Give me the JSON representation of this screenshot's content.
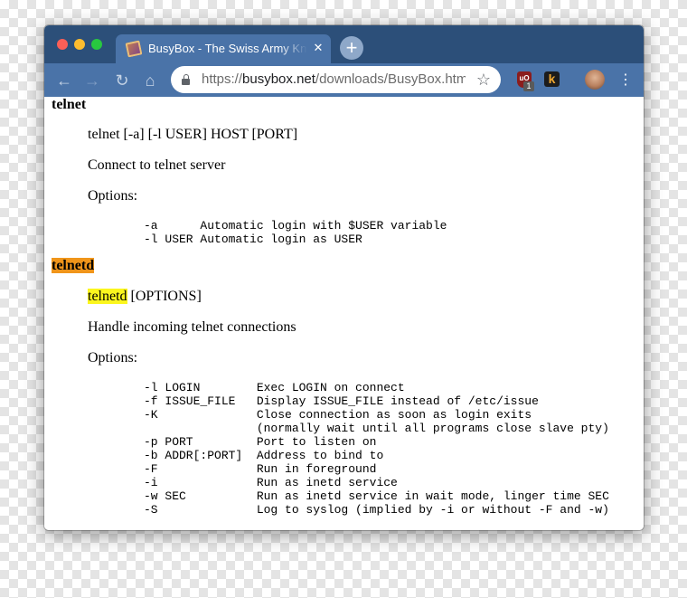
{
  "browser": {
    "tab_title": "BusyBox - The Swiss Army Knife of Embedded Linux",
    "tab_close": "✕",
    "new_tab": "+",
    "nav": {
      "back": "←",
      "forward": "→",
      "reload": "↻",
      "home": "⌂"
    },
    "url": {
      "scheme": "https://",
      "domain": "busybox.net",
      "path": "/downloads/BusyBox.html"
    },
    "bookmark_star": "☆",
    "extensions": {
      "ublock_label": "uO",
      "ublock_badge": "1",
      "k_label": "k"
    },
    "menu": "⋮",
    "colors": {
      "tabstrip": "#2c4f79",
      "toolbar": "#4a73a8",
      "highlight_orange": "#f0951a",
      "highlight_yellow": "#fbf61e"
    },
    "icons": [
      "lock-icon",
      "star-icon",
      "ublock-icon",
      "k-icon",
      "avatar",
      "menu-icon"
    ]
  },
  "page": {
    "telnet": {
      "title": "telnet",
      "usage": "telnet [-a] [-l USER] HOST [PORT]",
      "description": "Connect to telnet server",
      "options_label": "Options:",
      "options": "-a      Automatic login with $USER variable\n-l USER Automatic login as USER"
    },
    "telnetd": {
      "title": "telnetd",
      "usage_cmd": "telnetd",
      "usage_args": " [OPTIONS]",
      "description": "Handle incoming telnet connections",
      "options_label": "Options:",
      "options": "-l LOGIN        Exec LOGIN on connect\n-f ISSUE_FILE   Display ISSUE_FILE instead of /etc/issue\n-K              Close connection as soon as login exits\n                (normally wait until all programs close slave pty)\n-p PORT         Port to listen on\n-b ADDR[:PORT]  Address to bind to\n-F              Run in foreground\n-i              Run as inetd service\n-w SEC          Run as inetd service in wait mode, linger time SEC\n-S              Log to syslog (implied by -i or without -F and -w)"
    }
  }
}
